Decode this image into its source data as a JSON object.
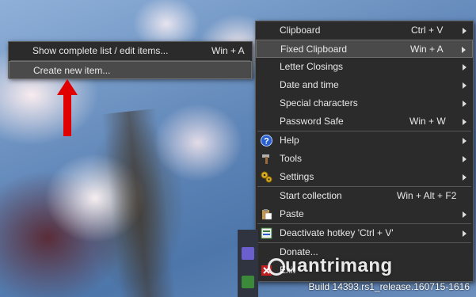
{
  "submenu": {
    "items": [
      {
        "label": "Show complete list / edit items...",
        "shortcut": "Win + A"
      },
      {
        "label": "Create new item..."
      }
    ]
  },
  "mainmenu": {
    "items": [
      {
        "label": "Clipboard",
        "shortcut": "Ctrl + V",
        "submenu": true
      },
      {
        "label": "Fixed Clipboard",
        "shortcut": "Win + A",
        "submenu": true,
        "highlighted": true
      },
      {
        "label": "Letter Closings",
        "submenu": true
      },
      {
        "label": "Date and time",
        "submenu": true
      },
      {
        "label": "Special characters",
        "submenu": true
      },
      {
        "label": "Password Safe",
        "shortcut": "Win + W",
        "submenu": true
      },
      {
        "label": "Help",
        "icon": "help-icon",
        "submenu": true
      },
      {
        "label": "Tools",
        "icon": "tools-icon",
        "submenu": true
      },
      {
        "label": "Settings",
        "icon": "settings-icon",
        "submenu": true
      },
      {
        "label": "Start collection",
        "shortcut": "Win + Alt + F2"
      },
      {
        "label": "Paste",
        "icon": "paste-icon",
        "submenu": true
      },
      {
        "label": "Deactivate hotkey  'Ctrl + V'",
        "icon": "deactivate-icon",
        "submenu": true
      },
      {
        "label": "Donate..."
      },
      {
        "label": "Exit",
        "icon": "exit-icon"
      }
    ]
  },
  "watermark": {
    "build": "Build 14393.rs1_release.160715-1616",
    "brand": "uantrimang"
  },
  "colors": {
    "menu_bg": "#2b2b2b",
    "highlight": "#4a4a4a",
    "arrow_red": "#e00000"
  }
}
